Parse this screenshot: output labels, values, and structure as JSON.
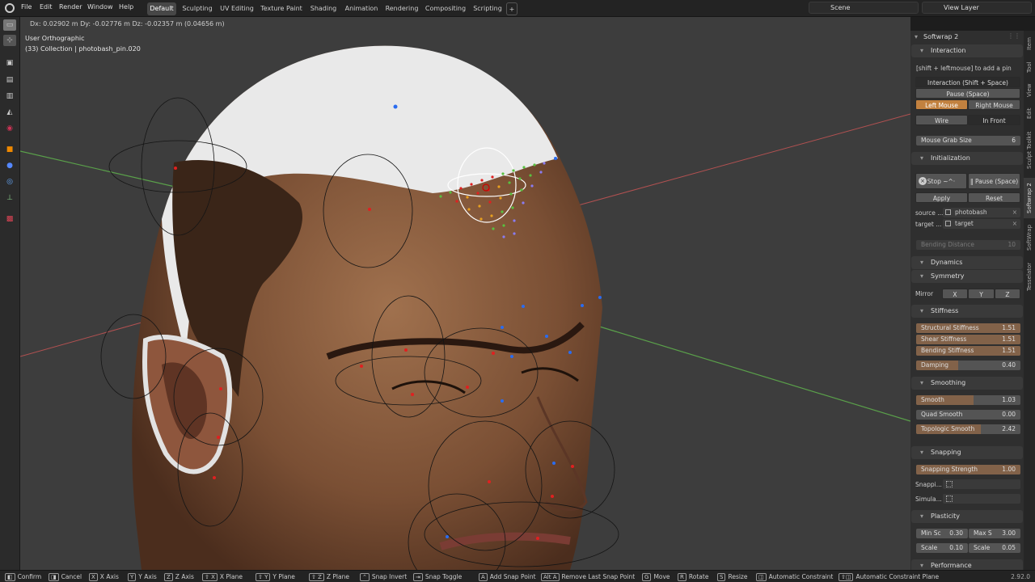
{
  "topbar": {
    "menus": [
      "File",
      "Edit",
      "Render",
      "Window",
      "Help"
    ],
    "workspaces": [
      "Default",
      "Sculpting",
      "UV Editing",
      "Texture Paint",
      "Shading",
      "Animation",
      "Rendering",
      "Compositing",
      "Scripting"
    ],
    "add_tab": "+",
    "scene": "Scene",
    "view_layer": "View Layer"
  },
  "viewport": {
    "transform_info": "Dx: 0.02902 m   Dy: -0.02776 m   Dz: -0.02357 m (0.04656 m)",
    "view_name": "User Orthographic",
    "collection": "(33) Collection | photobash_pin.020"
  },
  "panel": {
    "addon_title": "Softwrap 2",
    "interaction": {
      "header": "Interaction",
      "hint": "[shift + leftmouse] to add a pin",
      "interaction_button": "Interaction (Shift + Space)",
      "pause_button": "Pause (Space)",
      "left_mouse": "Left Mouse",
      "right_mouse": "Right Mouse",
      "wire": "Wire",
      "in_front": "In Front",
      "grab_label": "Mouse Grab Size",
      "grab_value": "6"
    },
    "initialization": {
      "header": "Initialization",
      "stop": "Stop ~^·",
      "pause": "Pause (Space)",
      "apply": "Apply",
      "reset": "Reset",
      "source_label": "source ...",
      "source_value": "photobash",
      "target_label": "target ...",
      "target_value": "target",
      "bending_label": "Bending Distance",
      "bending_value": "10"
    },
    "dynamics": {
      "header": "Dynamics"
    },
    "symmetry": {
      "header": "Symmetry",
      "mirror_label": "Mirror",
      "x": "X",
      "y": "Y",
      "z": "Z"
    },
    "stiffness": {
      "header": "Stiffness",
      "rows": [
        {
          "label": "Structural Stiffness",
          "value": "1.51",
          "fraction": 1.0
        },
        {
          "label": "Shear Stiffness",
          "value": "1.51",
          "fraction": 1.0
        },
        {
          "label": "Bending Stiffness",
          "value": "1.51",
          "fraction": 1.0
        },
        {
          "label": "Damping",
          "value": "0.40",
          "fraction": 0.4
        }
      ]
    },
    "smoothing": {
      "header": "Smoothing",
      "rows": [
        {
          "label": "Smooth",
          "value": "1.03",
          "fraction": 0.55
        },
        {
          "label": "Quad Smooth",
          "value": "0.00",
          "fraction": 0.0
        },
        {
          "label": "Topologic Smooth",
          "value": "2.42",
          "fraction": 0.62
        }
      ]
    },
    "snapping": {
      "header": "Snapping",
      "strength_label": "Snapping Strength",
      "strength_value": "1.00",
      "strength_fraction": 1.0,
      "snap_label": "Snappi...",
      "sim_label": "Simula..."
    },
    "plasticity": {
      "header": "Plasticity",
      "min_label": "Min Sc",
      "min_value": "0.30",
      "max_label": "Max S",
      "max_value": "3.00",
      "scale1_label": "Scale",
      "scale1_value": "0.10",
      "scale2_label": "Scale",
      "scale2_value": "0.05"
    },
    "performance": {
      "header": "Performance"
    }
  },
  "side_tabs": [
    "Item",
    "Tool",
    "View",
    "Edit",
    "Sculpt Toolkit",
    "Softwrap 2",
    "SoftWrap",
    "Tesselator"
  ],
  "statusbar": {
    "items": [
      {
        "key": "",
        "label": "Confirm"
      },
      {
        "key": "",
        "label": "Cancel"
      },
      {
        "key": "X",
        "label": "X Axis"
      },
      {
        "key": "Y",
        "label": "Y Axis"
      },
      {
        "key": "Z",
        "label": "Z Axis"
      },
      {
        "key": "⇧ X",
        "label": "X Plane"
      },
      {
        "key": "⇧ Y",
        "label": "Y Plane"
      },
      {
        "key": "⇧ Z",
        "label": "Z Plane"
      },
      {
        "key": "",
        "label": "Snap Invert"
      },
      {
        "key": "",
        "label": "Snap Toggle"
      },
      {
        "key": "A",
        "label": "Add Snap Point"
      },
      {
        "key": "Alt A",
        "label": "Remove Last Snap Point"
      },
      {
        "key": "G",
        "label": "Move"
      },
      {
        "key": "R",
        "label": "Rotate"
      },
      {
        "key": "S",
        "label": "Resize"
      },
      {
        "key": "",
        "label": "Automatic Constraint"
      },
      {
        "key": "",
        "label": "Automatic Constraint Plane"
      }
    ],
    "version": "2.92.0"
  },
  "colors": {
    "accent": "#c2813f",
    "slider_fill": "#826249",
    "panel_bg": "#2f2f2f"
  }
}
